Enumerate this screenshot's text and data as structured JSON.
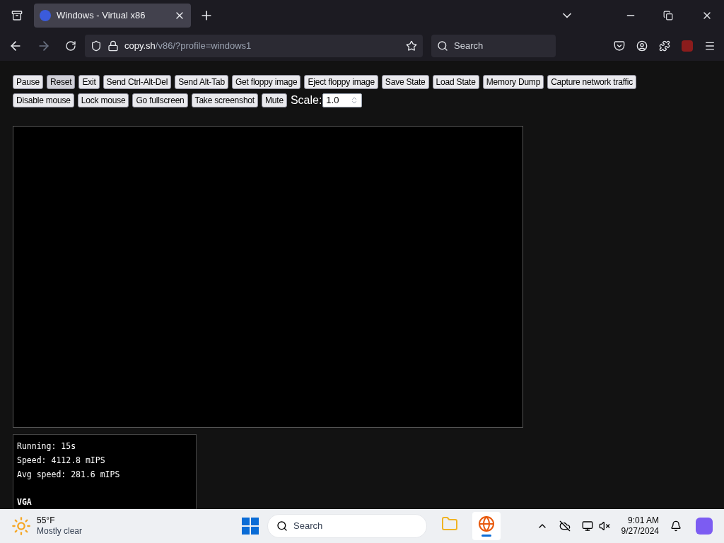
{
  "browser": {
    "tab": {
      "title": "Windows - Virtual x86",
      "selected": true
    },
    "url": {
      "host": "copy.sh",
      "path": "/v86/?profile=windows1"
    },
    "search": {
      "placeholder": "Search"
    }
  },
  "toolbar": {
    "buttons": [
      {
        "label": "Pause",
        "hovered": false
      },
      {
        "label": "Reset",
        "hovered": true
      },
      {
        "label": "Exit",
        "hovered": false
      },
      {
        "label": "Send Ctrl-Alt-Del",
        "hovered": false
      },
      {
        "label": "Send Alt-Tab",
        "hovered": false
      },
      {
        "label": "Get floppy image",
        "hovered": false
      },
      {
        "label": "Eject floppy image",
        "hovered": false
      },
      {
        "label": "Save State",
        "hovered": false
      },
      {
        "label": "Load State",
        "hovered": false
      },
      {
        "label": "Memory Dump",
        "hovered": false
      },
      {
        "label": "Capture network traffic",
        "hovered": false
      },
      {
        "label": "Disable mouse",
        "hovered": false
      },
      {
        "label": "Lock mouse",
        "hovered": false
      },
      {
        "label": "Go fullscreen",
        "hovered": false
      },
      {
        "label": "Take screenshot",
        "hovered": false
      },
      {
        "label": "Mute",
        "hovered": false
      }
    ],
    "scale": {
      "label": "Scale:",
      "value": "1.0"
    }
  },
  "info": {
    "lines": [
      "Running: 15s",
      "Speed: 4112.8 mIPS",
      "Avg speed: 281.6 mIPS"
    ],
    "heading": "VGA"
  },
  "taskbar": {
    "weather": {
      "temp": "55°F",
      "condition": "Mostly clear"
    },
    "search": {
      "placeholder": "Search"
    },
    "apps": [
      {
        "kind": "folder",
        "active": false
      },
      {
        "kind": "browser",
        "active": true
      }
    ],
    "time": "9:01 AM",
    "date": "9/27/2024"
  }
}
